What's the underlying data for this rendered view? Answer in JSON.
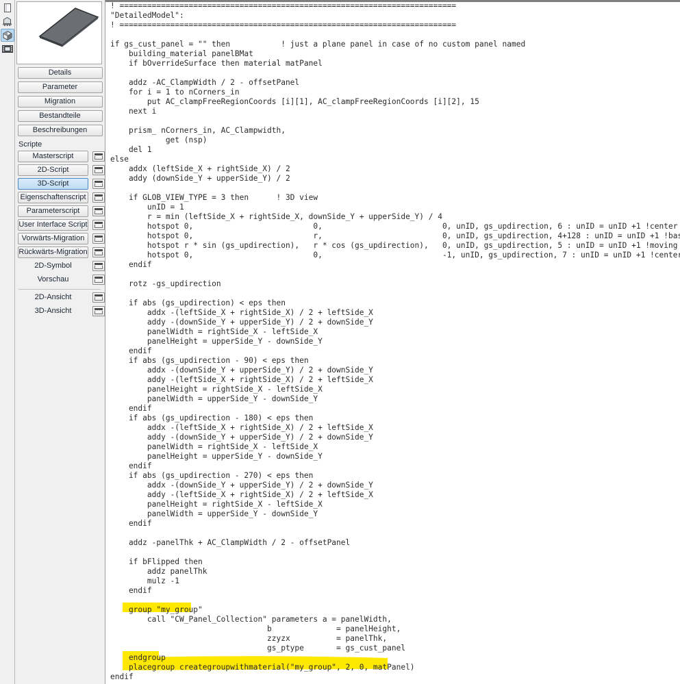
{
  "icon_rail": {
    "items": [
      {
        "name": "document-icon",
        "label": "Document",
        "selected": false
      },
      {
        "name": "symbol-2d-icon",
        "label": "2D Symbol",
        "selected": false
      },
      {
        "name": "cube-3d-icon",
        "label": "3D Model",
        "selected": true
      },
      {
        "name": "preview-film-icon",
        "label": "Preview",
        "selected": false
      }
    ]
  },
  "preview": {
    "alt": "3D preview of flat gray panel",
    "panel_fill": "#6b6f73",
    "panel_edge": "#2f3133",
    "background": "#ffffff"
  },
  "left_panel": {
    "top_buttons": [
      {
        "label": "Details"
      },
      {
        "label": "Parameter"
      },
      {
        "label": "Migration"
      },
      {
        "label": "Bestandteile"
      },
      {
        "label": "Beschreibungen"
      }
    ],
    "section_label": "Scripte",
    "scripts": [
      {
        "label": "Masterscript",
        "style": "button",
        "active": false,
        "window_icon": true
      },
      {
        "label": "2D-Script",
        "style": "button",
        "active": false,
        "window_icon": true
      },
      {
        "label": "3D-Script",
        "style": "button",
        "active": true,
        "window_icon": true
      },
      {
        "label": "Eigenschaftenscript",
        "style": "button",
        "active": false,
        "window_icon": true
      },
      {
        "label": "Parameterscript",
        "style": "button",
        "active": false,
        "window_icon": true
      },
      {
        "label": "User Interface Script",
        "style": "button",
        "active": false,
        "window_icon": true
      },
      {
        "label": "Vorwärts-Migration",
        "style": "button",
        "active": false,
        "window_icon": true
      },
      {
        "label": "Rückwärts-Migration",
        "style": "button",
        "active": false,
        "window_icon": true
      },
      {
        "label": "2D-Symbol",
        "style": "plain",
        "active": false,
        "window_icon": true
      },
      {
        "label": "Vorschau",
        "style": "plain",
        "active": false,
        "window_icon": true
      }
    ],
    "views": [
      {
        "label": "2D-Ansicht",
        "style": "plain",
        "active": false,
        "window_icon": true
      },
      {
        "label": "3D-Ansicht",
        "style": "plain",
        "active": false,
        "window_icon": true
      }
    ]
  },
  "editor": {
    "language": "GDL",
    "highlight_color": "#ffe800",
    "text_color": "#2b2b2b",
    "background": "#ffffff",
    "code": "! =========================================================================\n\"DetailedModel\":\n! =========================================================================\n\nif gs_cust_panel = \"\" then           ! just a plane panel in case of no custom panel named\n    building_material panelBMat\n    if bOverrideSurface then material matPanel\n\n    addz -AC_ClampWidth / 2 - offsetPanel\n    for i = 1 to nCorners_in\n        put AC_clampFreeRegionCoords [i][1], AC_clampFreeRegionCoords [i][2], 15\n    next i\n\n    prism_ nCorners_in, AC_Clampwidth,\n            get (nsp)\n    del 1\nelse\n    addx (leftSide_X + rightSide_X) / 2\n    addy (downSide_Y + upperSide_Y) / 2\n\n    if GLOB_VIEW_TYPE = 3 then      ! 3D view\n        unID = 1\n        r = min (leftSide_X + rightSide_X, downSide_Y + upperSide_Y) / 4\n        hotspot 0,                          0,                          0, unID, gs_updirection, 6 : unID = unID +1 !center of angle\n        hotspot 0,                          r,                          0, unID, gs_updirection, 4+128 : unID = unID +1 !base hotspot\n        hotspot r * sin (gs_updirection),   r * cos (gs_updirection),   0, unID, gs_updirection, 5 : unID = unID +1 !moving\n        hotspot 0,                          0,                          -1, unID, gs_updirection, 7 : unID = unID +1 !center of angle\n    endif\n\n    rotz -gs_updirection\n\n    if abs (gs_updirection) < eps then\n        addx -(leftSide_X + rightSide_X) / 2 + leftSide_X\n        addy -(downSide_Y + upperSide_Y) / 2 + downSide_Y\n        panelWidth = rightSide_X - leftSide_X\n        panelHeight = upperSide_Y - downSide_Y\n    endif\n    if abs (gs_updirection - 90) < eps then\n        addx -(downSide_Y + upperSide_Y) / 2 + downSide_Y\n        addy -(leftSide_X + rightSide_X) / 2 + leftSide_X\n        panelHeight = rightSide_X - leftSide_X\n        panelWidth = upperSide_Y - downSide_Y\n    endif\n    if abs (gs_updirection - 180) < eps then\n        addx -(leftSide_X + rightSide_X) / 2 + leftSide_X\n        addy -(downSide_Y + upperSide_Y) / 2 + downSide_Y\n        panelWidth = rightSide_X - leftSide_X\n        panelHeight = upperSide_Y - downSide_Y\n    endif\n    if abs (gs_updirection - 270) < eps then\n        addx -(downSide_Y + upperSide_Y) / 2 + downSide_Y\n        addy -(leftSide_X + rightSide_X) / 2 + leftSide_X\n        panelHeight = rightSide_X - leftSide_X\n        panelWidth = upperSide_Y - downSide_Y\n    endif\n\n    addz -panelThk + AC_ClampWidth / 2 - offsetPanel\n\n    if bFlipped then\n        addz panelThk\n        mulz -1\n    endif\n\n    group \"my_group\"\n        call \"CW_Panel_Collection\" parameters a = panelWidth,\n                                  b              = panelHeight,\n                                  zzyzx          = panelThk,\n                                  gs_ptype       = gs_cust_panel\n    endgroup\n    placegroup creategroupwithmaterial(\"my_group\", 2, 0, matPanel)\nendif",
    "highlighted_lines": [
      "group \"my_group\"",
      "endgroup",
      "placegroup creategroupwithmaterial(\"my_group\", 2, 0, matPanel)"
    ]
  }
}
